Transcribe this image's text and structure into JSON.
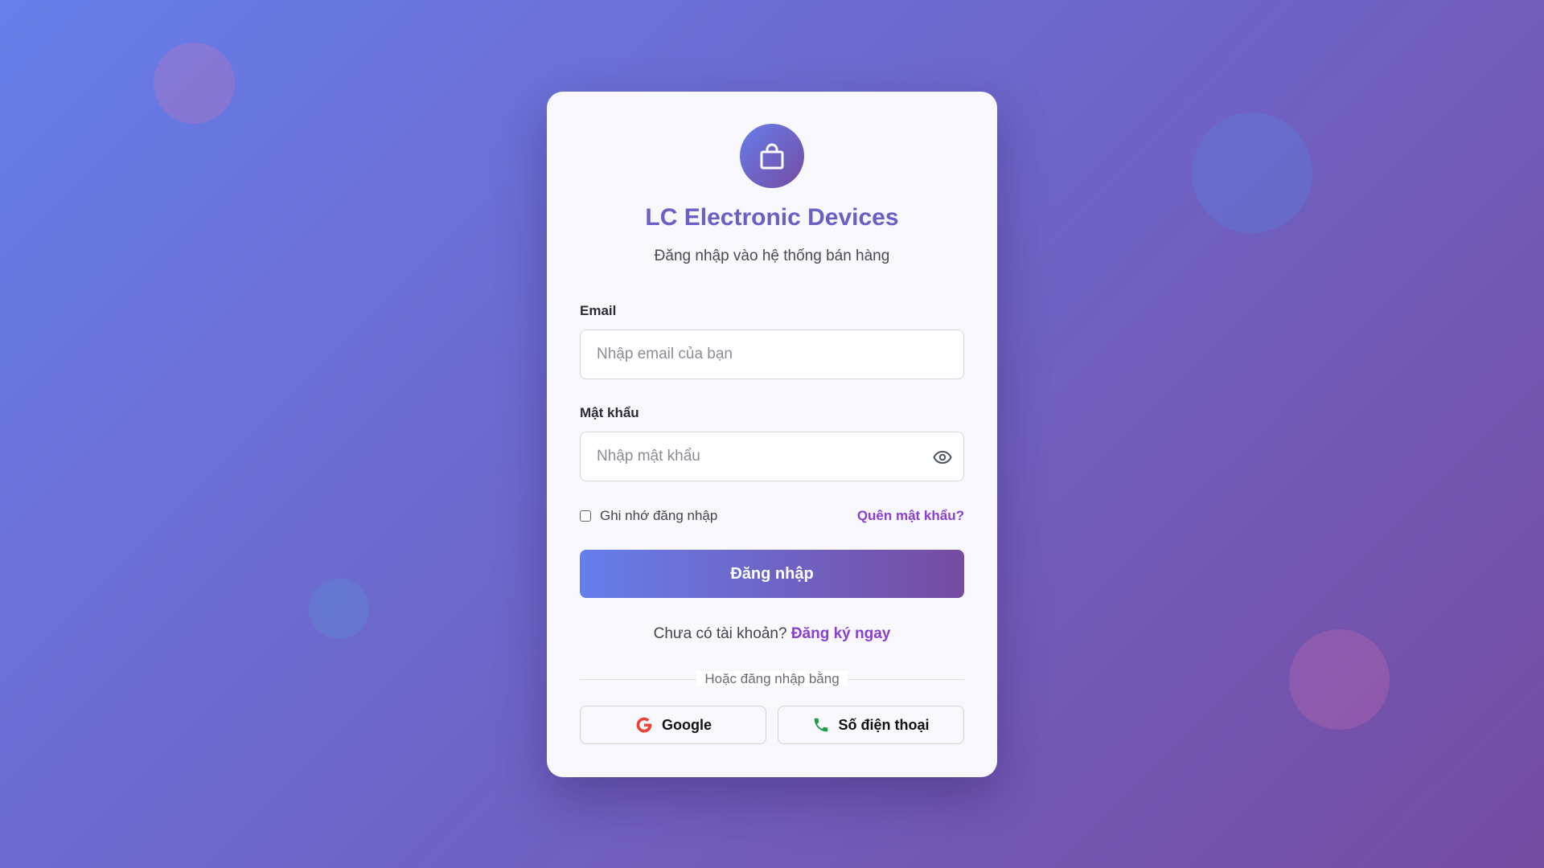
{
  "app": {
    "title": "LC Electronic Devices",
    "subtitle": "Đăng nhập vào hệ thống bán hàng"
  },
  "form": {
    "email_label": "Email",
    "email_placeholder": "Nhập email của bạn",
    "email_value": "",
    "password_label": "Mật khẩu",
    "password_placeholder": "Nhập mật khẩu",
    "password_value": "",
    "remember_label": "Ghi nhớ đăng nhập",
    "remember_checked": false,
    "forgot_link": "Quên mật khẩu?",
    "submit_label": "Đăng nhập"
  },
  "signup": {
    "prompt": "Chưa có tài khoản?",
    "link": "Đăng ký ngay"
  },
  "social": {
    "divider_text": "Hoặc đăng nhập bằng",
    "google_label": "Google",
    "phone_label": "Số điện thoại"
  },
  "icons": {
    "logo": "shopping-bag-icon",
    "password_toggle": "eye-icon",
    "google": "google-icon",
    "phone": "phone-icon"
  },
  "colors": {
    "gradient_start": "#667eea",
    "gradient_end": "#764ba2",
    "title": "#6a5fc4",
    "link": "#8a3fd0",
    "google_red": "#ea4335",
    "phone_green": "#1f9d4a"
  }
}
